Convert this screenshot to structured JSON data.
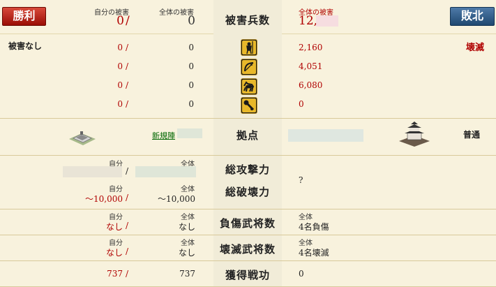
{
  "result": {
    "win_label": "勝利",
    "lose_label": "敗北"
  },
  "header": {
    "own_damage_label": "自分の被害",
    "total_damage_label": "全体の被害",
    "own_damage_value": "0",
    "total_damage_value": "0",
    "center_title": "被害兵数",
    "enemy_damage_label": "全体の被害",
    "enemy_damage_value": "12,"
  },
  "left_status": "被害なし",
  "right_status": "壊滅",
  "units": [
    {
      "icon": "spear-soldier-icon",
      "own": "0",
      "total": "0",
      "enemy": "2,160"
    },
    {
      "icon": "bow-icon",
      "own": "0",
      "total": "0",
      "enemy": "4,051"
    },
    {
      "icon": "horse-icon",
      "own": "0",
      "total": "0",
      "enemy": "6,080"
    },
    {
      "icon": "siege-weapon-icon",
      "own": "0",
      "total": "0",
      "enemy": "0"
    }
  ],
  "base": {
    "center_label": "拠点",
    "left_name": "新規陣",
    "right_type": "普通"
  },
  "attack": {
    "label1": "総攻撃力",
    "label2": "総破壊力",
    "own_label": "自分",
    "total_label": "全体",
    "own_label2": "自分",
    "total_label2": "全体",
    "own_destroy": "～10,000",
    "total_destroy": "～10,000",
    "enemy_value": "?"
  },
  "injured": {
    "label": "負傷武将数",
    "own_label": "自分",
    "total_label": "全体",
    "own_value": "なし",
    "total_value": "なし",
    "enemy_label": "全体",
    "enemy_value": "4名負傷"
  },
  "destroyed": {
    "label": "壊滅武将数",
    "own_label": "自分",
    "total_label": "全体",
    "own_value": "なし",
    "total_value": "なし",
    "enemy_label": "全体",
    "enemy_value": "4名壊滅"
  },
  "merit": {
    "label": "獲得戦功",
    "own_value": "737",
    "total_value": "737",
    "enemy_value": "0"
  },
  "colors": {
    "win": "#b01a0f",
    "lose": "#2a5482",
    "value_red": "#b00000",
    "background": "#f8f2dd"
  }
}
